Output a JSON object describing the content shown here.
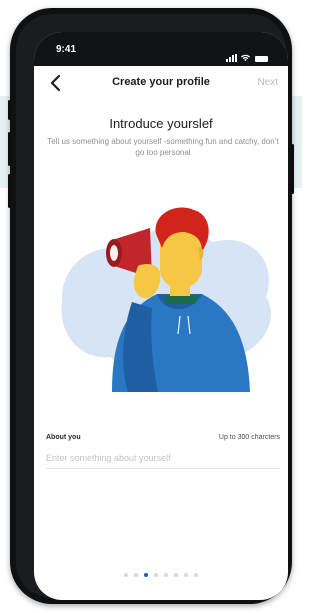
{
  "status_bar": {
    "time": "9:41",
    "signal_icon": "signal-bars-icon",
    "wifi_icon": "wifi-icon",
    "battery_icon": "battery-icon"
  },
  "nav": {
    "back_icon": "chevron-left-icon",
    "title": "Create your profile",
    "next_label": "Next"
  },
  "intro": {
    "heading": "Introduce yourslef",
    "subtext": "Tell us something about yourself -something fun and catchy, don’t go too personal"
  },
  "illustration": {
    "name": "person-with-megaphone-illustration",
    "colors": {
      "blob": "#d6e4f5",
      "hoodie": "#2a78c4",
      "hoodie_dark": "#1f5ea3",
      "skin": "#f6c744",
      "hair": "#d1251c",
      "megaphone": "#c0262a"
    }
  },
  "about_field": {
    "label": "About you",
    "limit_label": "Up to 300 charcters",
    "placeholder": "Enter something about yourself",
    "value": ""
  },
  "pagination": {
    "total": 8,
    "active_index": 2
  },
  "colors": {
    "accent": "#1f5fbf",
    "next_disabled": "#b9bcc2"
  }
}
